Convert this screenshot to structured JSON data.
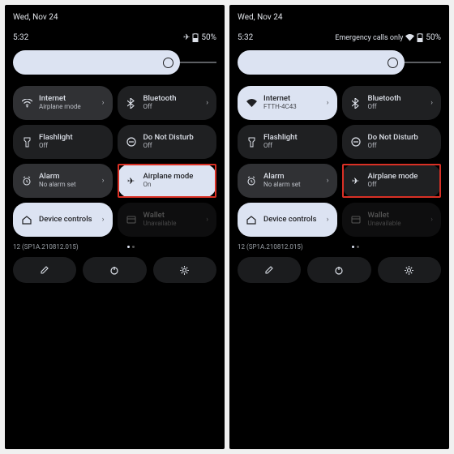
{
  "shared": {
    "date": "Wed, Nov 24",
    "time": "5:32",
    "battery_text": "50%",
    "build": "12 (SP1A.210812.015)",
    "tiles": {
      "internet_label": "Internet",
      "bluetooth_label": "Bluetooth",
      "bluetooth_sub": "Off",
      "flashlight_label": "Flashlight",
      "flashlight_sub": "Off",
      "dnd_label": "Do Not Disturb",
      "dnd_sub": "Off",
      "alarm_label": "Alarm",
      "alarm_sub": "No alarm set",
      "airplane_label": "Airplane mode",
      "devctrl_label": "Device controls",
      "wallet_label": "Wallet",
      "wallet_sub": "Unavailable"
    }
  },
  "left": {
    "internet_sub": "Airplane mode",
    "airplane_sub": "On",
    "airplane_active": true,
    "emergency": ""
  },
  "right": {
    "internet_sub": "FTTH-4C43",
    "airplane_sub": "Off",
    "airplane_active": false,
    "emergency": "Emergency calls only"
  }
}
